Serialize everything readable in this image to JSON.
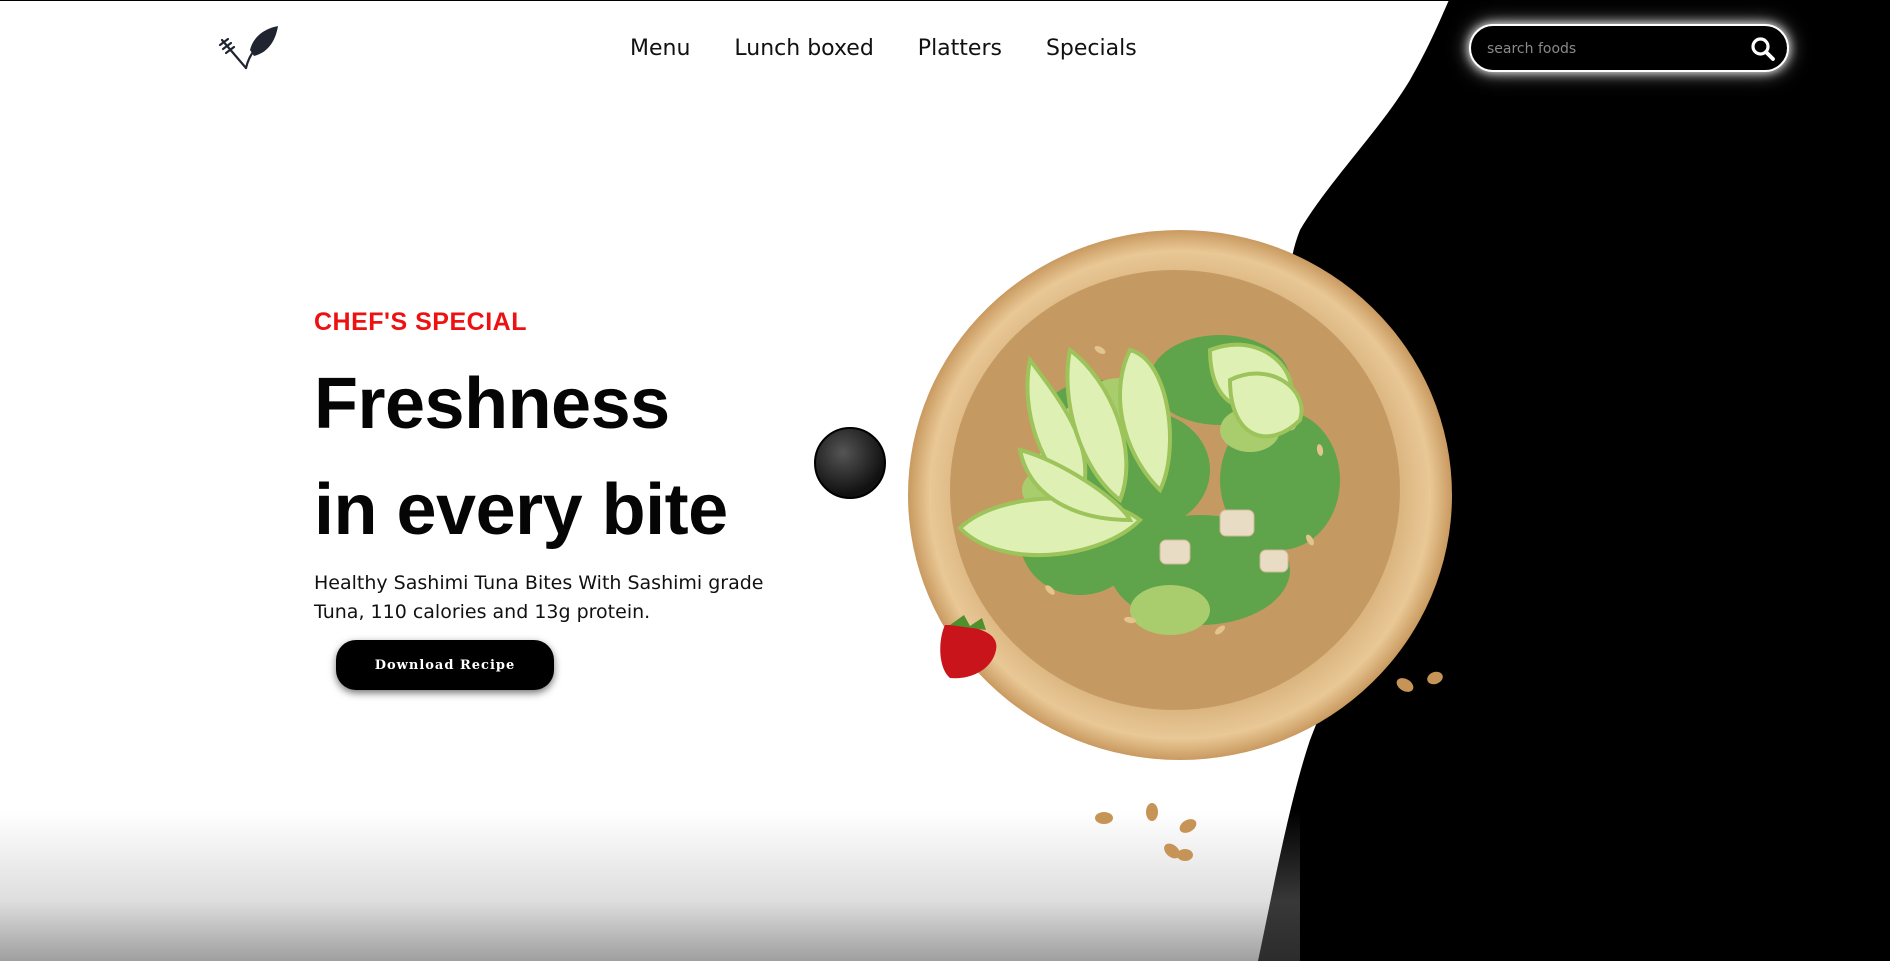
{
  "brand": {
    "logo_icon": "fork-leaf-logo-icon"
  },
  "nav": {
    "items": [
      {
        "label": "Menu"
      },
      {
        "label": "Lunch boxed"
      },
      {
        "label": "Platters"
      },
      {
        "label": "Specials"
      }
    ]
  },
  "search": {
    "placeholder": "search foods",
    "value": "",
    "icon": "search-icon"
  },
  "hero": {
    "eyebrow": "CHEF'S SPECIAL",
    "headline_line1": "Freshness",
    "headline_line2": "in every bite",
    "description": "Healthy Sashimi Tuna Bites With Sashimi grade Tuna, 110 calories and 13g protein.",
    "cta_label": "Download  Recipe"
  },
  "colors": {
    "accent_red": "#ee1111",
    "text": "#050505",
    "background": "#ffffff",
    "dark_panel": "#000000"
  }
}
